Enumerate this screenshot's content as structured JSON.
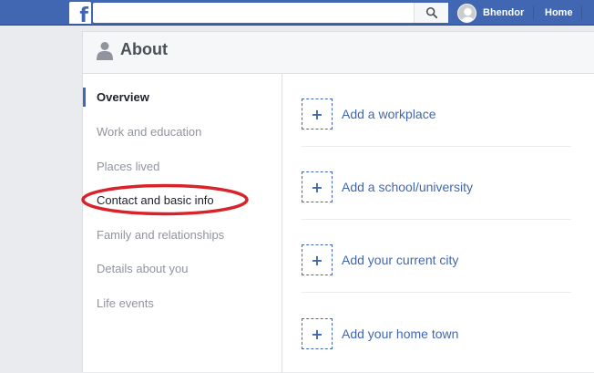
{
  "topbar": {
    "logo_letter": "f",
    "search_value": "",
    "search_icon": "search-icon",
    "profile_name": "Bhendor",
    "nav_home": "Home",
    "brand_color": "#4267b2"
  },
  "about": {
    "title": "About",
    "title_icon": "person-silhouette-icon"
  },
  "sidebar": {
    "items": [
      {
        "label": "Overview",
        "active": true
      },
      {
        "label": "Work and education"
      },
      {
        "label": "Places lived"
      },
      {
        "label": "Contact and basic info",
        "annotated": true
      },
      {
        "label": "Family and relationships"
      },
      {
        "label": "Details about you"
      },
      {
        "label": "Life events"
      }
    ],
    "annotation_color": "#d9232a"
  },
  "overview": {
    "actions": [
      {
        "label": "Add a workplace",
        "icon": "plus-icon",
        "icon_glyph": "+"
      },
      {
        "label": "Add a school/university",
        "icon": "plus-icon",
        "icon_glyph": "+"
      },
      {
        "label": "Add your current city",
        "icon": "plus-icon",
        "icon_glyph": "+"
      },
      {
        "label": "Add your home town",
        "icon": "plus-icon",
        "icon_glyph": "+"
      }
    ]
  }
}
